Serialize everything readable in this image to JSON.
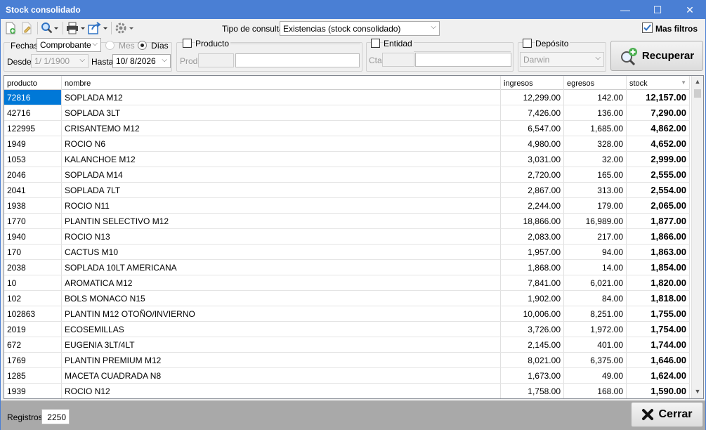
{
  "window": {
    "title": "Stock consolidado",
    "minimize_glyph": "—",
    "maximize_glyph": "☐",
    "close_glyph": "✕",
    "accent_color": "#4a7fd4"
  },
  "toolbar": {
    "icons": [
      "new-doc-icon",
      "edit-doc-icon",
      "search-icon",
      "print-icon",
      "export-icon",
      "settings-icon"
    ]
  },
  "query": {
    "label": "Tipo de consulta",
    "value": "Existencias (stock consolidado)",
    "mas_filtros_label": "Mas filtros",
    "mas_filtros_checked": true
  },
  "fechas": {
    "label": "Fechas",
    "type_value": "Comprobante",
    "mes_label": "Mes",
    "dias_label": "Días",
    "desde_label": "Desde",
    "desde_value": "1/ 1/1900",
    "hasta_label": "Hasta",
    "hasta_value": "10/ 8/2026"
  },
  "producto": {
    "label": "Producto",
    "prod_label": "Prod.",
    "checked": false
  },
  "entidad": {
    "label": "Entidad",
    "cta_label": "Cta",
    "checked": false
  },
  "deposito": {
    "label": "Depósito",
    "value": "Darwin",
    "checked": false
  },
  "recuperar_label": "Recuperar",
  "grid": {
    "columns": [
      "producto",
      "nombre",
      "ingresos",
      "egresos",
      "stock"
    ],
    "rows": [
      [
        "72816",
        "SOPLADA M12",
        "12,299.00",
        "142.00",
        "12,157.00"
      ],
      [
        "42716",
        "SOPLADA 3LT",
        "7,426.00",
        "136.00",
        "7,290.00"
      ],
      [
        "122995",
        "CRISANTEMO M12",
        "6,547.00",
        "1,685.00",
        "4,862.00"
      ],
      [
        "1949",
        "ROCIO N6",
        "4,980.00",
        "328.00",
        "4,652.00"
      ],
      [
        "1053",
        "KALANCHOE M12",
        "3,031.00",
        "32.00",
        "2,999.00"
      ],
      [
        "2046",
        "SOPLADA M14",
        "2,720.00",
        "165.00",
        "2,555.00"
      ],
      [
        "2041",
        "SOPLADA 7LT",
        "2,867.00",
        "313.00",
        "2,554.00"
      ],
      [
        "1938",
        "ROCIO N11",
        "2,244.00",
        "179.00",
        "2,065.00"
      ],
      [
        "1770",
        "PLANTIN SELECTIVO M12",
        "18,866.00",
        "16,989.00",
        "1,877.00"
      ],
      [
        "1940",
        "ROCIO N13",
        "2,083.00",
        "217.00",
        "1,866.00"
      ],
      [
        "170",
        "CACTUS M10",
        "1,957.00",
        "94.00",
        "1,863.00"
      ],
      [
        "2038",
        "SOPLADA 10LT AMERICANA",
        "1,868.00",
        "14.00",
        "1,854.00"
      ],
      [
        "10",
        "AROMATICA M12",
        "7,841.00",
        "6,021.00",
        "1,820.00"
      ],
      [
        "102",
        "BOLS MONACO N15",
        "1,902.00",
        "84.00",
        "1,818.00"
      ],
      [
        "102863",
        "PLANTIN M12 OTOÑO/INVIERNO",
        "10,006.00",
        "8,251.00",
        "1,755.00"
      ],
      [
        "2019",
        "ECOSEMILLAS",
        "3,726.00",
        "1,972.00",
        "1,754.00"
      ],
      [
        "672",
        "EUGENIA 3LT/4LT",
        "2,145.00",
        "401.00",
        "1,744.00"
      ],
      [
        "1769",
        "PLANTIN PREMIUM M12",
        "8,021.00",
        "6,375.00",
        "1,646.00"
      ],
      [
        "1285",
        "MACETA CUADRADA N8",
        "1,673.00",
        "49.00",
        "1,624.00"
      ],
      [
        "1939",
        "ROCIO N12",
        "1,758.00",
        "168.00",
        "1,590.00"
      ]
    ],
    "selected_row": 0,
    "sort_column": "stock",
    "selection_color": "#0078d7"
  },
  "footer": {
    "registros_label": "Registros",
    "registros_value": "2250",
    "cerrar_label": "Cerrar"
  }
}
